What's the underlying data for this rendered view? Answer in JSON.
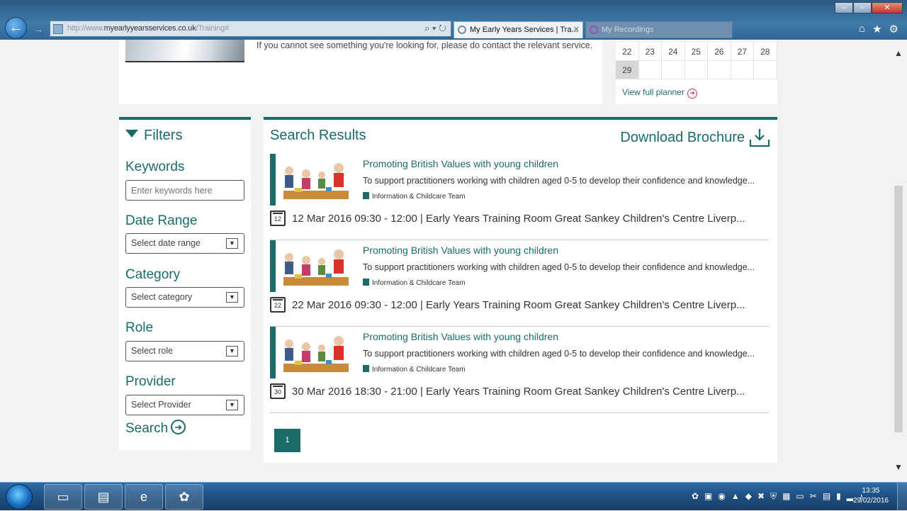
{
  "browser": {
    "url_prefix": "http://",
    "url_host": "myearlyyearsservices.co.uk",
    "url_path": "/Training#",
    "tabs": [
      {
        "label": "My Early Years Services | Tra..."
      },
      {
        "label": "My Recordings"
      }
    ]
  },
  "intro": {
    "text": "If you cannot see something you're looking for, please do contact the relevant service."
  },
  "calendar": {
    "row1": [
      "22",
      "23",
      "24",
      "25",
      "26",
      "27",
      "28"
    ],
    "row2": [
      "29",
      "",
      "",
      "",
      "",
      "",
      ""
    ],
    "today": "29",
    "view_link": "View full planner"
  },
  "filters": {
    "title": "Filters",
    "keywords": {
      "label": "Keywords",
      "placeholder": "Enter keywords here"
    },
    "date_range": {
      "label": "Date Range",
      "value": "Select date range"
    },
    "category": {
      "label": "Category",
      "value": "Select category"
    },
    "role": {
      "label": "Role",
      "value": "Select role"
    },
    "provider": {
      "label": "Provider",
      "value": "Select Provider"
    },
    "search_label": "Search"
  },
  "results": {
    "title": "Search Results",
    "download_label": "Download Brochure",
    "items": [
      {
        "title": "Promoting British Values with young children",
        "description": "To support practitioners working with children aged 0-5 to develop their confidence and knowledge...",
        "tag": "Information & Childcare Team",
        "day": "12",
        "datetime": "12 Mar 2016 09:30 - 12:00  |  Early Years Training Room Great Sankey Children's Centre Liverp..."
      },
      {
        "title": "Promoting British Values with young children",
        "description": "To support practitioners working with children aged 0-5 to develop their confidence and knowledge...",
        "tag": "Information & Childcare Team",
        "day": "22",
        "datetime": "22 Mar 2016 09:30 - 12:00  |  Early Years Training Room Great Sankey Children's Centre Liverp..."
      },
      {
        "title": "Promoting British Values with young children",
        "description": "To support practitioners working with children aged 0-5 to develop their confidence and knowledge...",
        "tag": "Information & Childcare Team",
        "day": "30",
        "datetime": "30 Mar 2016 18:30 - 21:00  |  Early Years Training Room Great Sankey Children's Centre Liverp..."
      }
    ],
    "page": "1"
  },
  "taskbar": {
    "time": "13:35",
    "date": "29/02/2016"
  },
  "colors": {
    "accent": "#1a6b6a",
    "link_arrow": "#b03a66"
  }
}
